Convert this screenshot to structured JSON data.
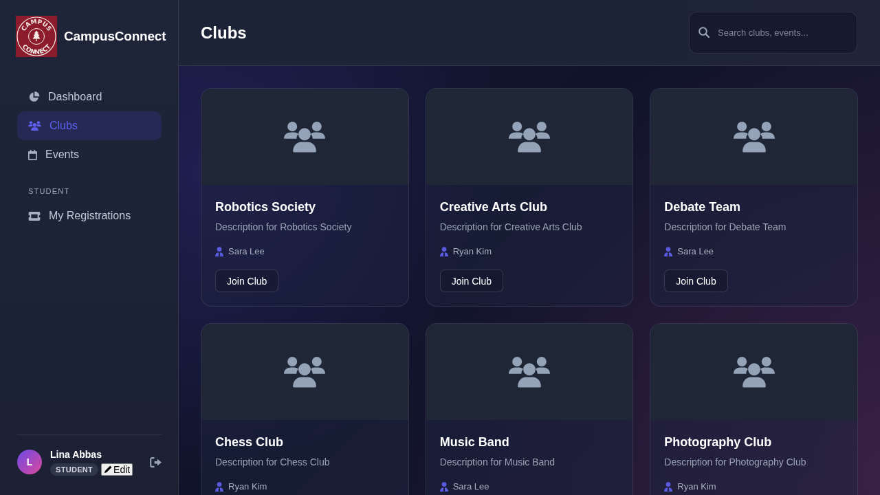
{
  "sidebar": {
    "logo": {
      "top_text": "CAMPUS",
      "bottom_text": "CONNECT"
    },
    "brand": "CampusConnect",
    "nav": [
      {
        "label": "Dashboard",
        "selected": false
      },
      {
        "label": "Clubs",
        "selected": true
      },
      {
        "label": "Events",
        "selected": false
      }
    ],
    "sections": [
      {
        "title": "STUDENT",
        "items": [
          {
            "label": "My Registrations",
            "selected": false
          }
        ]
      }
    ],
    "user": {
      "initial": "L",
      "name": "Lina Abbas",
      "role": "STUDENT",
      "edit_label": "Edit"
    }
  },
  "header": {
    "title": "Clubs",
    "search": {
      "placeholder": "Search clubs, events..."
    }
  },
  "clubs": [
    {
      "name": "Robotics Society",
      "description": "Description for Robotics Society",
      "leader": "Sara Lee",
      "action": "Join Club"
    },
    {
      "name": "Creative Arts Club",
      "description": "Description for Creative Arts Club",
      "leader": "Ryan Kim",
      "action": "Join Club"
    },
    {
      "name": "Debate Team",
      "description": "Description for Debate Team",
      "leader": "Sara Lee",
      "action": "Join Club"
    },
    {
      "name": "Chess Club",
      "description": "Description for Chess Club",
      "leader": "Ryan Kim"
    },
    {
      "name": "Music Band",
      "description": "Description for Music Band",
      "leader": "Sara Lee"
    },
    {
      "name": "Photography Club",
      "description": "Description for Photography Club",
      "leader": "Ryan Kim"
    }
  ]
}
